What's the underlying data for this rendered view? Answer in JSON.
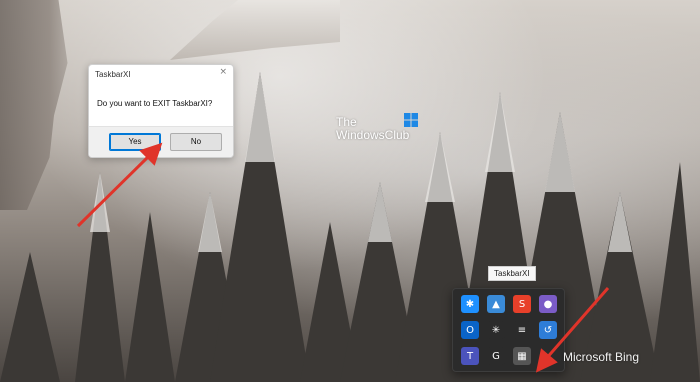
{
  "dialog": {
    "title": "TaskbarXI",
    "close": "×",
    "message": "Do you want to EXIT TaskbarXI?",
    "yes_label": "Yes",
    "no_label": "No"
  },
  "watermark": {
    "line1": "The",
    "line2": "WindowsClub"
  },
  "tooltip": {
    "text": "TaskbarXI"
  },
  "tray": {
    "icons": [
      {
        "name": "bluetooth-icon",
        "glyph": "✱",
        "color": "#1e90ff"
      },
      {
        "name": "azure-warning-icon",
        "glyph": "▲",
        "color": "#3a8bd8"
      },
      {
        "name": "shotcut-s-icon",
        "glyph": "S",
        "color": "#e8402a"
      },
      {
        "name": "teams-chat-icon",
        "glyph": "●",
        "color": "#7b5cc7"
      },
      {
        "name": "outlook-icon",
        "glyph": "O",
        "color": "#0a64c8"
      },
      {
        "name": "slack-icon",
        "glyph": "✳",
        "color": "#2b2b2b"
      },
      {
        "name": "notes-icon",
        "glyph": "≡",
        "color": "#2b2b2b"
      },
      {
        "name": "network-sync-icon",
        "glyph": "↺",
        "color": "#2e7dd7"
      },
      {
        "name": "teams-icon",
        "glyph": "T",
        "color": "#4b53bc"
      },
      {
        "name": "grammarly-icon",
        "glyph": "G",
        "color": "#2b2b2b"
      },
      {
        "name": "taskbarxi-icon",
        "glyph": "▦",
        "color": "#555555"
      }
    ]
  },
  "bing": {
    "text": "Microsoft Bing"
  },
  "colors": {
    "arrow": "#e0342a",
    "accent": "#0078d7"
  }
}
